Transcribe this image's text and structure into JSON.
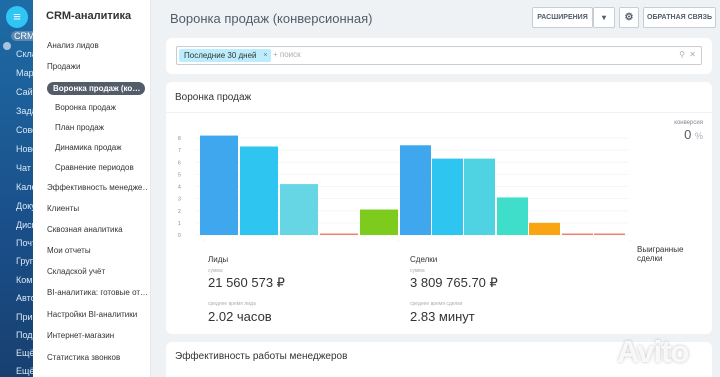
{
  "rail": {
    "items": [
      "CRM",
      "Скла",
      "Марк",
      "Сайт",
      "Зада",
      "Сове",
      "Новс",
      "Чат и",
      "Кале",
      "Доку",
      "Диск",
      "Почт",
      "Груп",
      "Комп",
      "Авто",
      "При",
      "Под",
      "Ещё",
      "Ещё"
    ]
  },
  "sidebar": {
    "brand": "CRM-аналитика",
    "items": [
      {
        "label": "Анализ лидов",
        "level": 0
      },
      {
        "label": "Продажи",
        "level": 0
      },
      {
        "label": "Воронка продаж (кон…",
        "level": 0,
        "active": true
      },
      {
        "label": "Воронка продаж",
        "level": 1
      },
      {
        "label": "План продаж",
        "level": 1
      },
      {
        "label": "Динамика продаж",
        "level": 1
      },
      {
        "label": "Сравнение периодов",
        "level": 1
      },
      {
        "label": "Эффективность менедже…",
        "level": 0
      },
      {
        "label": "Клиенты",
        "level": 0
      },
      {
        "label": "Сквозная аналитика",
        "level": 0
      },
      {
        "label": "Мои отчеты",
        "level": 0
      },
      {
        "label": "Складской учёт",
        "level": 0
      },
      {
        "label": "BI-аналитика: готовые от…",
        "level": 0
      },
      {
        "label": "Настройки BI-аналитики",
        "level": 0
      },
      {
        "label": "Интернет-магазин",
        "level": 0
      },
      {
        "label": "Статистика звонков",
        "level": 0
      }
    ]
  },
  "header": {
    "title": "Воронка продаж (конверсионная)",
    "extensions_label": "РАСШИРЕНИЯ",
    "feedback_label": "ОБРАТНАЯ СВЯЗЬ"
  },
  "filter": {
    "chip": "Последние 30 дней",
    "chip_close": "×",
    "placeholder": "+ поиск",
    "search_icon": "⚲",
    "clear_icon": "✕"
  },
  "funnel_card": {
    "title": "Воронка продаж",
    "conversion_label": "конверсия",
    "conversion_value": "0",
    "conversion_unit": "%",
    "leads": {
      "title": "Лиды",
      "sum_label": "сумма",
      "sum": "21 560 573 ₽",
      "time_label": "среднее время лида",
      "time": "2.02 часов"
    },
    "deals": {
      "title": "Сделки",
      "sum_label": "сумма",
      "sum": "3 809 765.70 ₽",
      "time_label": "среднее время сделки",
      "time": "2.83 минут"
    },
    "won_label": "Выигранные сделки"
  },
  "chart_data": {
    "type": "bar",
    "y_ticks": [
      "8",
      "7",
      "6",
      "5",
      "4",
      "3",
      "2",
      "1",
      "0"
    ],
    "ylim": [
      0,
      8
    ],
    "bars": [
      {
        "value": 8.2,
        "color": "#3fa7ee"
      },
      {
        "value": 7.3,
        "color": "#2ec6f1"
      },
      {
        "value": 4.2,
        "color": "#67d6e4"
      },
      {
        "value": 0.1,
        "color": "#f0826e"
      },
      {
        "value": 2.1,
        "color": "#7ccb1d"
      },
      {
        "value": 7.4,
        "color": "#3fa7ee"
      },
      {
        "value": 6.3,
        "color": "#2ec6f1"
      },
      {
        "value": 6.3,
        "color": "#4fd2e2"
      },
      {
        "value": 3.1,
        "color": "#3edecb"
      },
      {
        "value": 1.0,
        "color": "#f9a513"
      },
      {
        "value": 0.1,
        "color": "#f0826e"
      },
      {
        "value": 0.1,
        "color": "#f0826e"
      }
    ]
  },
  "efficiency_card": {
    "title": "Эффективность работы менеджеров"
  },
  "watermark": "Avito"
}
